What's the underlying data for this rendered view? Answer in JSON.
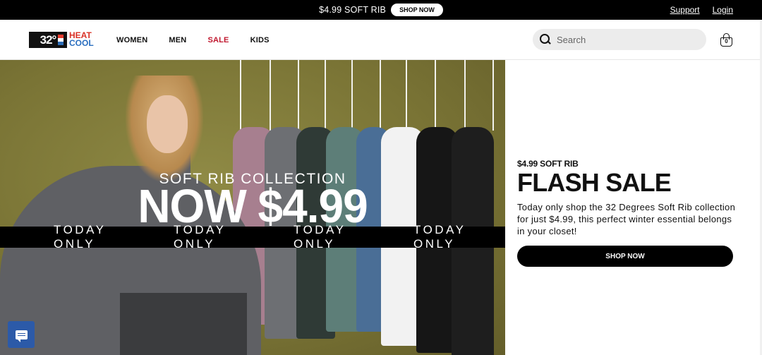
{
  "announcement": {
    "text": "$4.99 SOFT RIB",
    "button_label": "SHOP NOW",
    "links": [
      "Support",
      "Login"
    ]
  },
  "header": {
    "logo": {
      "mark": "32°",
      "line1": "HEAT",
      "line2": "COOL"
    },
    "nav": [
      "WOMEN",
      "MEN",
      "SALE",
      "KIDS"
    ],
    "search": {
      "placeholder": "Search",
      "icon": "search-icon"
    },
    "cart": {
      "icon": "shopping-bag-icon",
      "count": "0"
    }
  },
  "hero": {
    "kicker": "SOFT RIB COLLECTION",
    "headline": "NOW $4.99",
    "ticker": [
      "TODAY ONLY",
      "TODAY ONLY",
      "TODAY ONLY",
      "TODAY ONLY"
    ]
  },
  "promo": {
    "kicker": "$4.99 SOFT RIB",
    "title": "FLASH SALE",
    "body": "Today only shop the 32 Degrees Soft Rib collection for just $4.99, this perfect winter essential belongs in your closet!",
    "button_label": "SHOP NOW"
  },
  "chat": {
    "icon": "chat-icon"
  },
  "colors": {
    "announcement_bg": "#000000",
    "sale_accent": "#c0172e",
    "hero_bg": "#7b7436",
    "chat_bg": "#2c5aa8"
  }
}
